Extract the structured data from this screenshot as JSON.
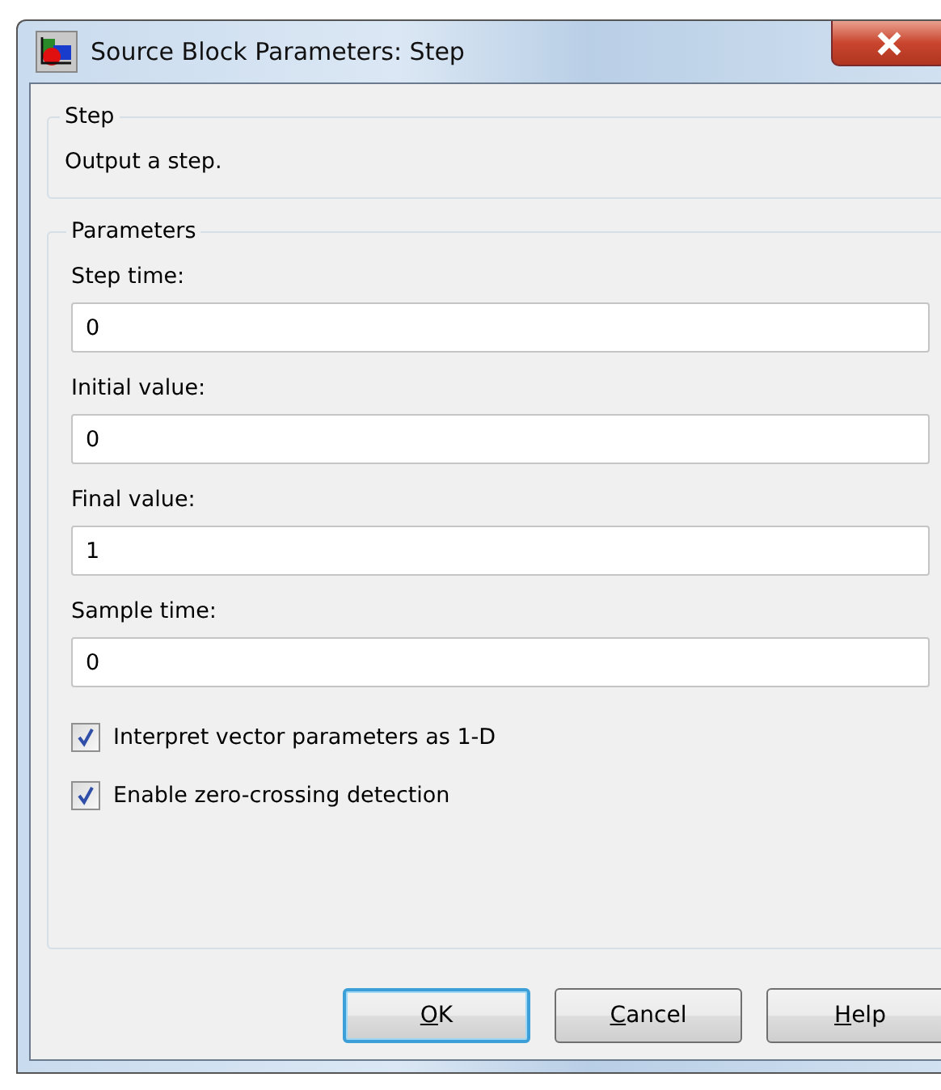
{
  "window": {
    "title": "Source Block Parameters: Step"
  },
  "description_group": {
    "title": "Step",
    "text": "Output a step."
  },
  "parameters_group": {
    "title": "Parameters",
    "fields": [
      {
        "label": "Step time:",
        "value": "0"
      },
      {
        "label": "Initial value:",
        "value": "0"
      },
      {
        "label": "Final value:",
        "value": "1"
      },
      {
        "label": "Sample time:",
        "value": "0"
      }
    ],
    "checkboxes": [
      {
        "label": "Interpret vector parameters as 1-D",
        "checked": true
      },
      {
        "label": "Enable zero-crossing detection",
        "checked": true
      }
    ]
  },
  "buttons": [
    {
      "label": "OK",
      "default": true,
      "underline_first": true
    },
    {
      "label": "Cancel",
      "default": false,
      "underline_first": true
    },
    {
      "label": "Help",
      "default": false,
      "underline_first": true
    }
  ]
}
